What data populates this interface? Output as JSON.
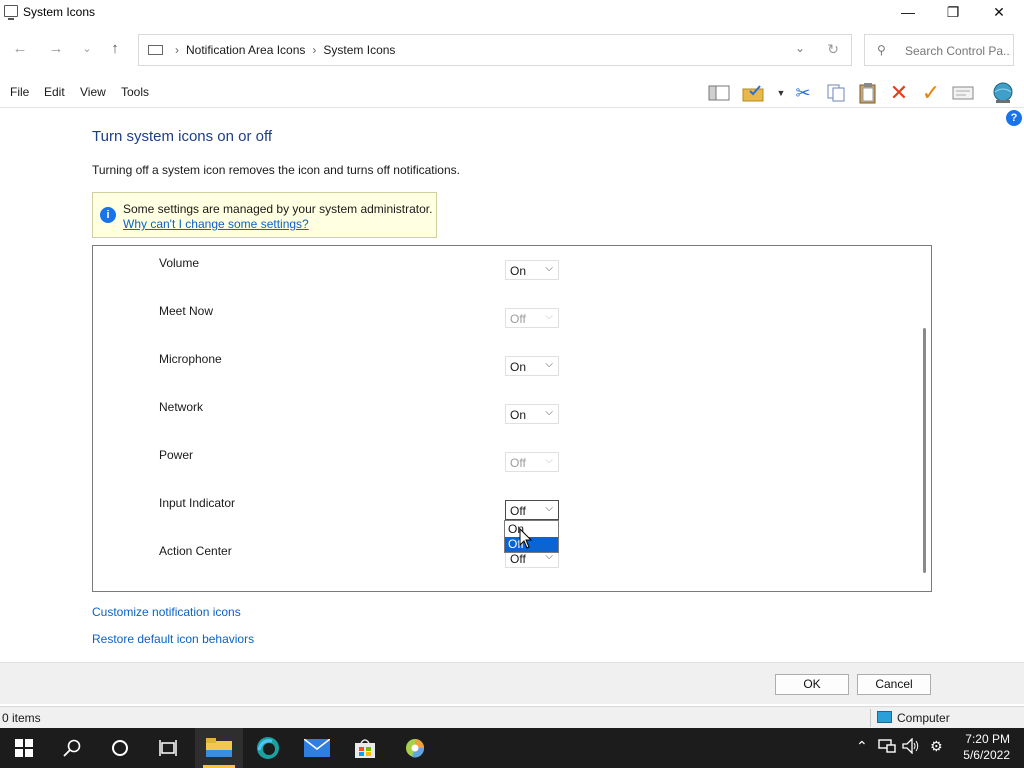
{
  "window": {
    "title": "System Icons",
    "minimize_glyph": "—",
    "maximize_glyph": "❐",
    "close_glyph": "✕"
  },
  "nav": {
    "back_glyph": "←",
    "forward_glyph": "→",
    "recent_glyph": "⌄",
    "up_glyph": "↑",
    "breadcrumbs": [
      "Notification Area Icons",
      "System Icons"
    ],
    "search_placeholder": "Search Control Pa..."
  },
  "menu": [
    "File",
    "Edit",
    "View",
    "Tools"
  ],
  "content": {
    "heading": "Turn system icons on or off",
    "description": "Turning off a system icon removes the icon and turns off notifications.",
    "info_message": "Some settings are managed by your system administrator.",
    "info_link": "Why can't I change some settings?",
    "icons": [
      {
        "label": "Volume",
        "value": "On",
        "enabled": true
      },
      {
        "label": "Meet Now",
        "value": "Off",
        "enabled": false
      },
      {
        "label": "Microphone",
        "value": "On",
        "enabled": true
      },
      {
        "label": "Network",
        "value": "On",
        "enabled": true
      },
      {
        "label": "Power",
        "value": "Off",
        "enabled": false
      },
      {
        "label": "Input Indicator",
        "value": "Off",
        "enabled": true
      },
      {
        "label": "Action Center",
        "value": "Off",
        "enabled": true
      }
    ],
    "dropdown_options": [
      "On",
      "Off"
    ],
    "dropdown_highlighted": "Off",
    "link_customize": "Customize notification icons",
    "link_restore": "Restore default icon behaviors"
  },
  "buttons": {
    "ok": "OK",
    "cancel": "Cancel"
  },
  "status": {
    "items": "0 items",
    "location": "Computer"
  },
  "clock": {
    "time": "7:20 PM",
    "date": "5/6/2022"
  },
  "colors": {
    "accent": "#0a64d2",
    "heading": "#1e3e86",
    "link": "#0b63c5",
    "info_bg": "#ffffe1"
  }
}
